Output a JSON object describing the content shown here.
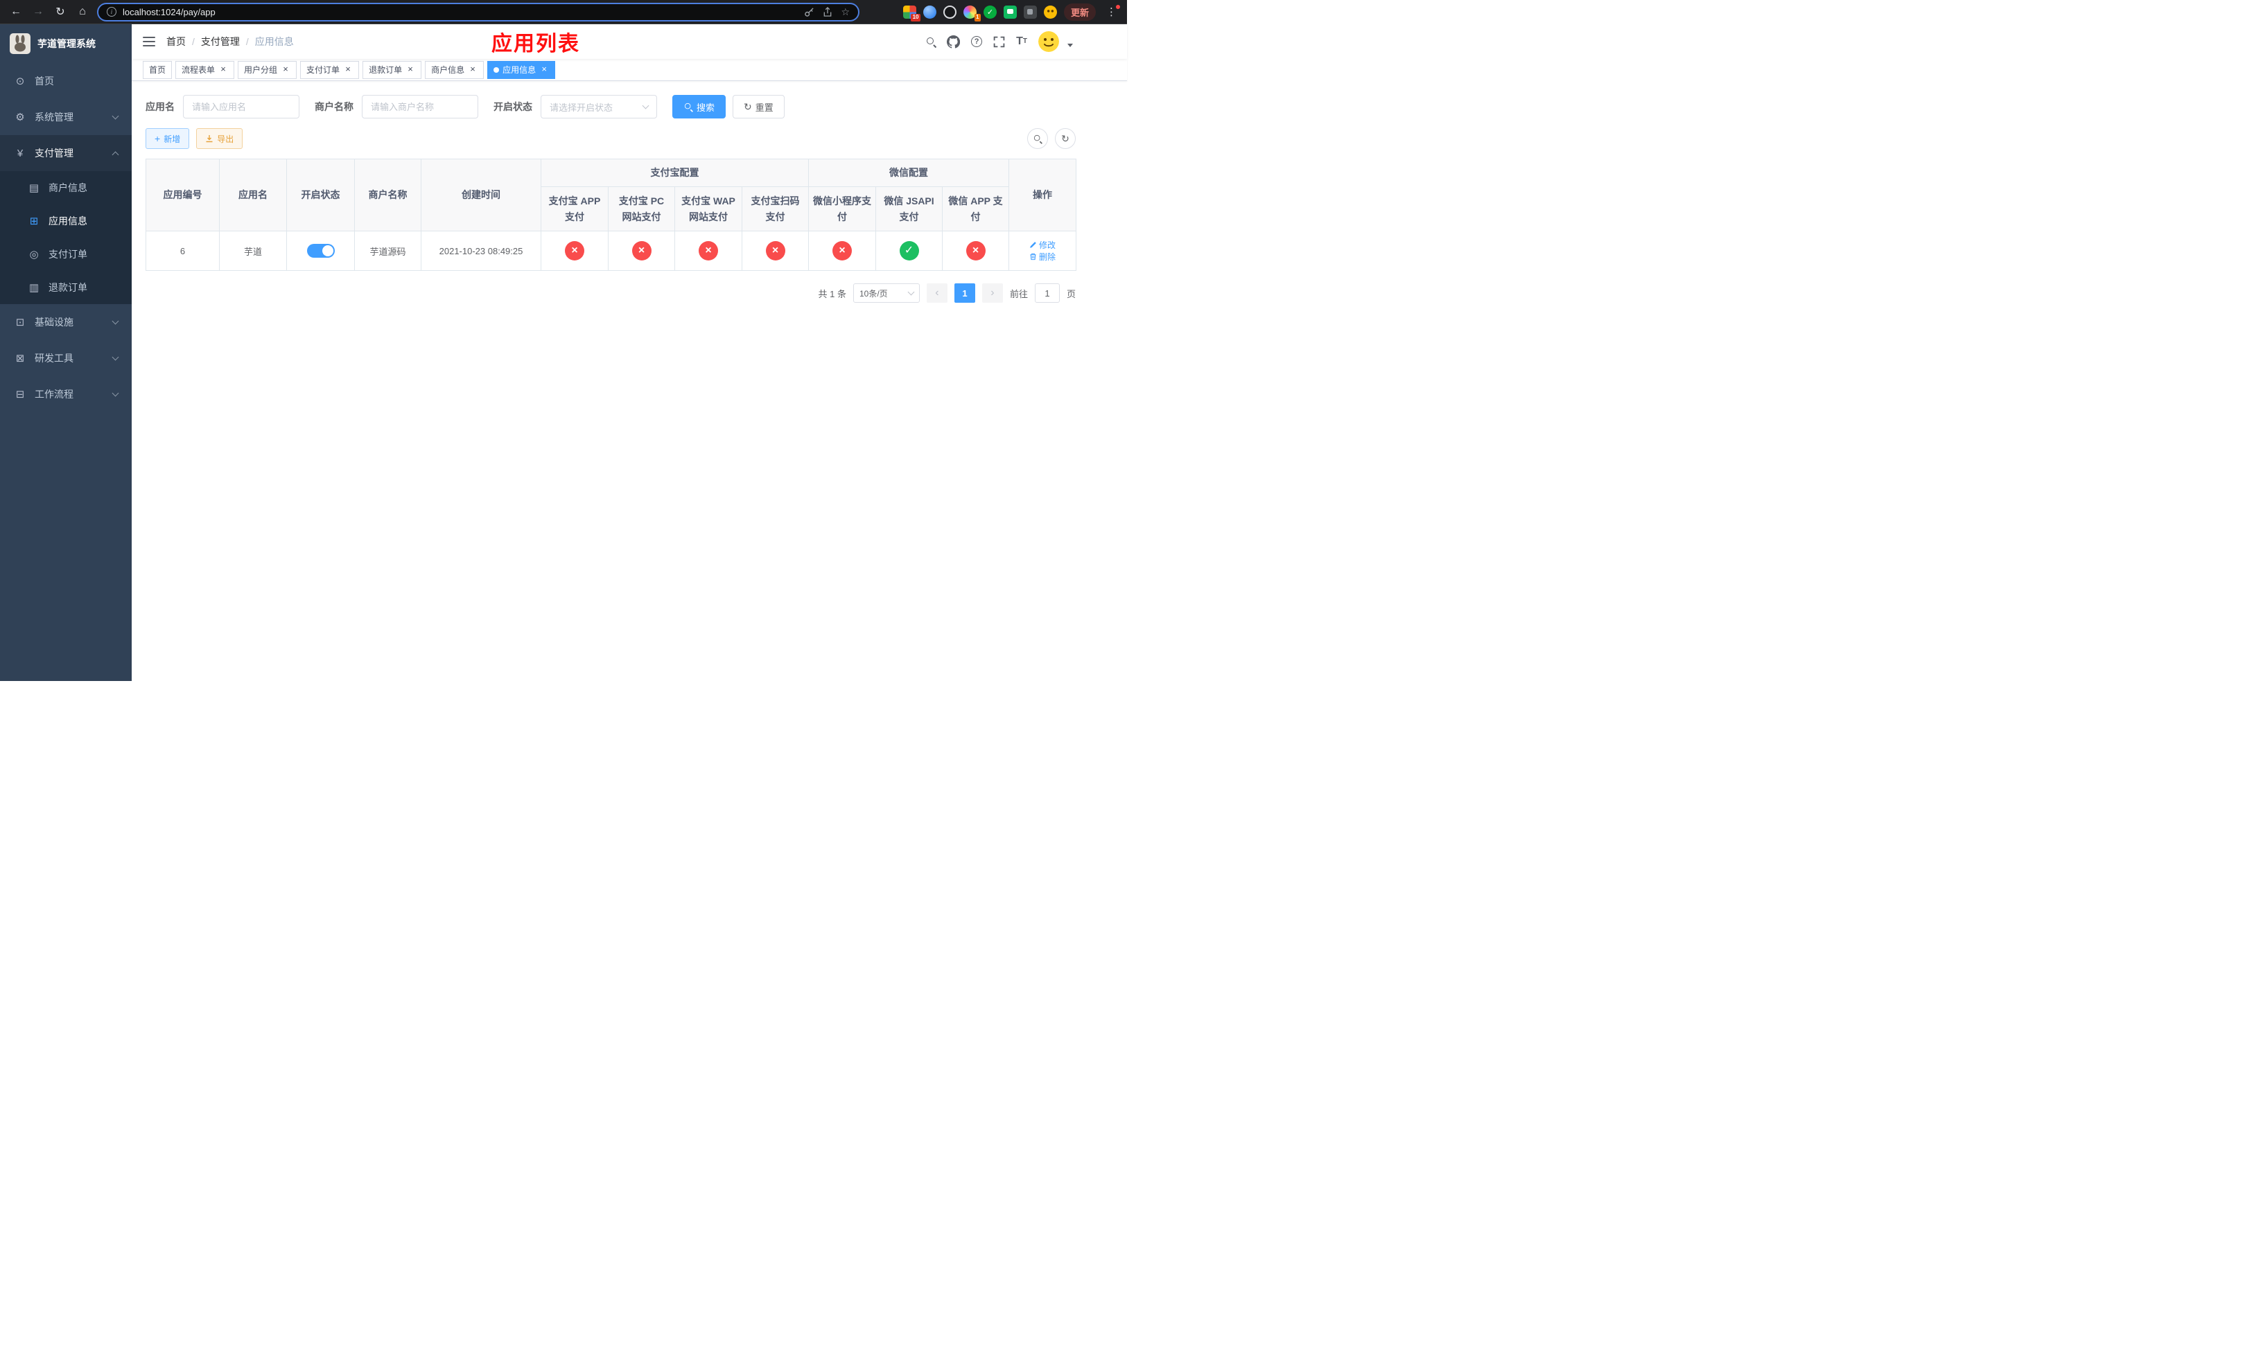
{
  "colors": {
    "primary": "#409eff",
    "success": "#1dbf62",
    "danger": "#f94c4c",
    "warning": "#e6a23c",
    "page_title": "#ff1010"
  },
  "icons": {
    "back": "←",
    "forward": "→",
    "reload": "↻",
    "home": "⌂",
    "star": "☆",
    "overflow_menu": "⋮",
    "info": "i",
    "dashboard": "⊙",
    "gear": "⚙",
    "yen": "¥",
    "merchant": "▤",
    "app_grid": "⊞",
    "pay_order": "◎",
    "refund": "▥",
    "infra": "⊡",
    "devtool": "⊠",
    "workflow": "⊟",
    "plus": "+",
    "refresh": "↻",
    "check": "✓",
    "cross": "×",
    "close": "×",
    "question": "?",
    "prev": "‹",
    "next": "›"
  },
  "browser": {
    "url": "localhost:1024/pay/app",
    "update_label": "更新",
    "ext_badge_a": "10",
    "ext_badge_b": "1"
  },
  "sidebar": {
    "app_title": "芋道管理系统",
    "items": [
      {
        "label": "首页"
      },
      {
        "label": "系统管理"
      },
      {
        "label": "支付管理"
      },
      {
        "label": "基础设施"
      },
      {
        "label": "研发工具"
      },
      {
        "label": "工作流程"
      }
    ],
    "pay_children": [
      {
        "label": "商户信息"
      },
      {
        "label": "应用信息"
      },
      {
        "label": "支付订单"
      },
      {
        "label": "退款订单"
      }
    ]
  },
  "navbar": {
    "breadcrumb": [
      "首页",
      "支付管理",
      "应用信息"
    ],
    "page_title": "应用列表"
  },
  "tabs": [
    {
      "label": "首页"
    },
    {
      "label": "流程表单"
    },
    {
      "label": "用户分组"
    },
    {
      "label": "支付订单"
    },
    {
      "label": "退款订单"
    },
    {
      "label": "商户信息"
    },
    {
      "label": "应用信息"
    }
  ],
  "filters": {
    "app_name_label": "应用名",
    "app_name_placeholder": "请输入应用名",
    "merchant_label": "商户名称",
    "merchant_placeholder": "请输入商户名称",
    "status_label": "开启状态",
    "status_placeholder": "请选择开启状态",
    "search_button": "搜索",
    "reset_button": "重置"
  },
  "toolbar": {
    "add_button": "新增",
    "export_button": "导出"
  },
  "table": {
    "columns": {
      "id": "应用编号",
      "name": "应用名",
      "status": "开启状态",
      "merchant": "商户名称",
      "created": "创建时间",
      "actions": "操作"
    },
    "groups": {
      "alipay": "支付宝配置",
      "wechat": "微信配置"
    },
    "alipay_columns": [
      "支付宝 APP 支付",
      "支付宝 PC 网站支付",
      "支付宝 WAP 网站支付",
      "支付宝扫码支付"
    ],
    "wechat_columns": [
      "微信小程序支付",
      "微信 JSAPI 支付",
      "微信 APP 支付"
    ],
    "rows": [
      {
        "id": "6",
        "name": "芋道",
        "enabled": true,
        "merchant": "芋道源码",
        "created": "2021-10-23 08:49:25",
        "configs": [
          "disabled",
          "disabled",
          "disabled",
          "disabled",
          "disabled",
          "enabled",
          "disabled"
        ],
        "edit_label": "修改",
        "delete_label": "删除"
      }
    ]
  },
  "pagination": {
    "total": "共 1 条",
    "page_size": "10条/页",
    "current_page": "1",
    "goto_prefix": "前往",
    "goto_value": "1",
    "goto_suffix": "页"
  }
}
